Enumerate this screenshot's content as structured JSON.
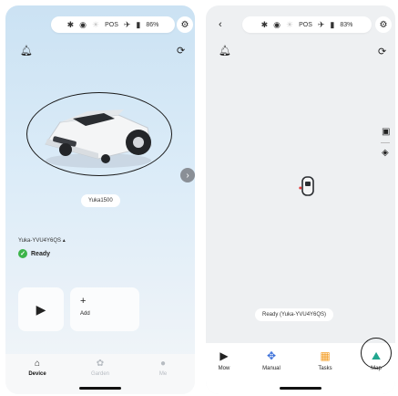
{
  "left": {
    "status_bar": {
      "bluetooth": "✱",
      "wifi": "◉",
      "sun": "☀",
      "pos": "POS",
      "satellite": "✈",
      "battery": "▮",
      "battery_pct": "86%"
    },
    "model_label": "Yuka1500",
    "device_name": "Yuka-YVU4Y6QS",
    "device_caret": "▴",
    "status_text": "Ready",
    "add_label": "Add",
    "tabs": [
      {
        "label": "Device",
        "active": true
      },
      {
        "label": "Garden",
        "active": false
      },
      {
        "label": "Me",
        "active": false
      }
    ]
  },
  "right": {
    "status_bar": {
      "bluetooth": "✱",
      "wifi": "◉",
      "sun": "☀",
      "pos": "POS",
      "satellite": "✈",
      "battery": "▮",
      "battery_pct": "83%"
    },
    "ready_text": "Ready  (Yuka-YVU4Y6QS)",
    "tabs": [
      {
        "label": "Mow"
      },
      {
        "label": "Manual"
      },
      {
        "label": "Tasks"
      },
      {
        "label": "Map"
      }
    ]
  },
  "colors": {
    "ready_green": "#3cb44a",
    "manual_blue": "#3a6fd9",
    "tasks_orange": "#f39a1e",
    "map_teal": "#22a68f"
  }
}
